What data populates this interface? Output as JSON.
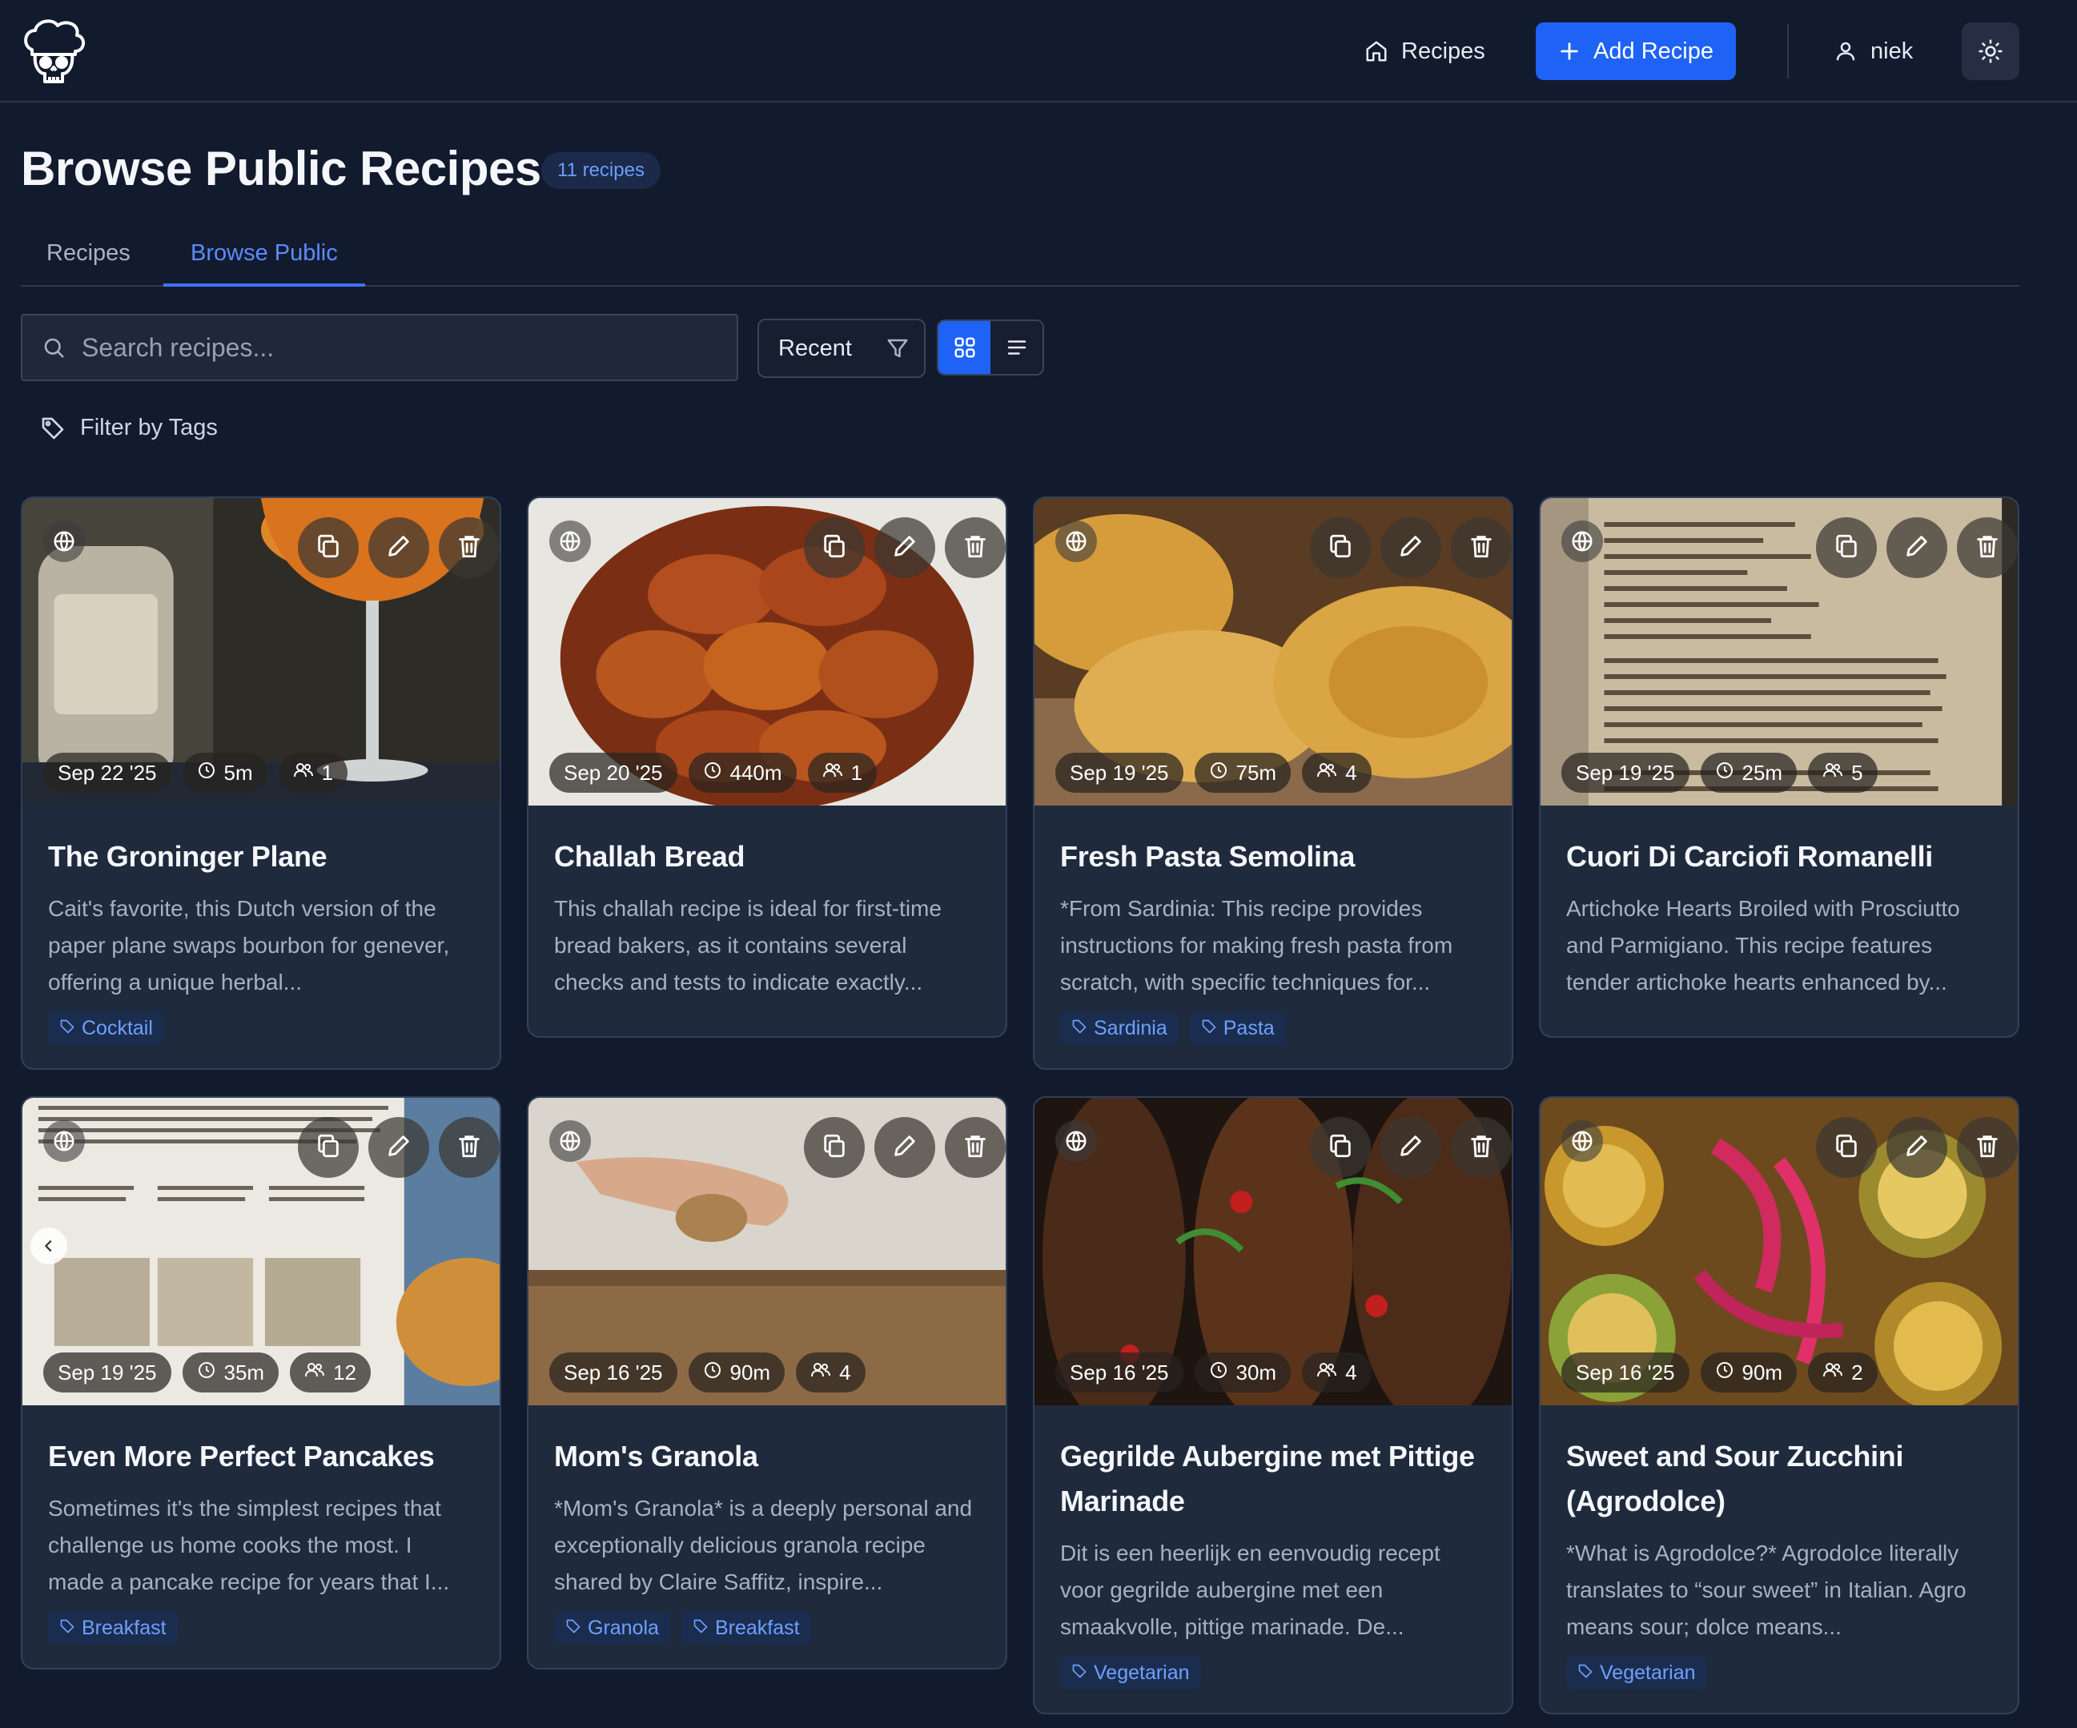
{
  "nav": {
    "recipes_label": "Recipes",
    "add_recipe_label": "Add Recipe",
    "user_name": "niek"
  },
  "header": {
    "title": "Browse Public Recipes",
    "count_badge": "11 recipes"
  },
  "tabs": [
    {
      "label": "Recipes",
      "active": false
    },
    {
      "label": "Browse Public",
      "active": true
    }
  ],
  "toolbar": {
    "search_placeholder": "Search recipes...",
    "sort_label": "Recent",
    "view_mode": "grid"
  },
  "filter": {
    "label": "Filter by Tags"
  },
  "colors": {
    "accent": "#1e63f5",
    "background": "#121a2e",
    "card": "#1f2a3d",
    "tag_text": "#6fa0ff"
  },
  "recipes": [
    {
      "title": "The Groninger Plane",
      "date": "Sep 22 '25",
      "time": "5m",
      "servings": "1",
      "description": "Cait's favorite, this Dutch version of the paper plane swaps bourbon for genever, offering a unique herbal...",
      "tags": [
        "Cocktail"
      ],
      "image": "cocktail"
    },
    {
      "title": "Challah Bread",
      "date": "Sep 20 '25",
      "time": "440m",
      "servings": "1",
      "description": "This challah recipe is ideal for first-time bread bakers, as it contains several checks and tests to indicate exactly...",
      "tags": [],
      "image": "bread"
    },
    {
      "title": "Fresh Pasta Semolina",
      "date": "Sep 19 '25",
      "time": "75m",
      "servings": "4",
      "description": "*From Sardinia: This recipe provides instructions for making fresh pasta from scratch, with specific techniques for...",
      "tags": [
        "Sardinia",
        "Pasta"
      ],
      "image": "pasta"
    },
    {
      "title": "Cuori Di Carciofi Romanelli",
      "date": "Sep 19 '25",
      "time": "25m",
      "servings": "5",
      "description": "Artichoke Hearts Broiled with Prosciutto and Parmigiano. This recipe features tender artichoke hearts enhanced by...",
      "tags": [],
      "image": "book"
    },
    {
      "title": "Even More Perfect Pancakes",
      "date": "Sep 19 '25",
      "time": "35m",
      "servings": "12",
      "description": "Sometimes it's the simplest recipes that challenge us home cooks the most. I made a pancake recipe for years that I...",
      "tags": [
        "Breakfast"
      ],
      "image": "pancakes"
    },
    {
      "title": "Mom's Granola",
      "date": "Sep 16 '25",
      "time": "90m",
      "servings": "4",
      "description": "*Mom's Granola* is a deeply personal and exceptionally delicious granola recipe shared by Claire Saffitz, inspire...",
      "tags": [
        "Granola",
        "Breakfast"
      ],
      "image": "granola"
    },
    {
      "title": "Gegrilde Aubergine met Pittige Marinade",
      "date": "Sep 16 '25",
      "time": "30m",
      "servings": "4",
      "description": "Dit is een heerlijk en eenvoudig recept voor gegrilde aubergine met een smaakvolle, pittige marinade. De...",
      "tags": [
        "Vegetarian"
      ],
      "image": "aubergine"
    },
    {
      "title": "Sweet and Sour Zucchini (Agrodolce)",
      "date": "Sep 16 '25",
      "time": "90m",
      "servings": "2",
      "description": "*What is Agrodolce?* Agrodolce literally translates to “sour sweet” in Italian. Agro means sour; dolce means...",
      "tags": [
        "Vegetarian"
      ],
      "image": "zucchini"
    }
  ]
}
